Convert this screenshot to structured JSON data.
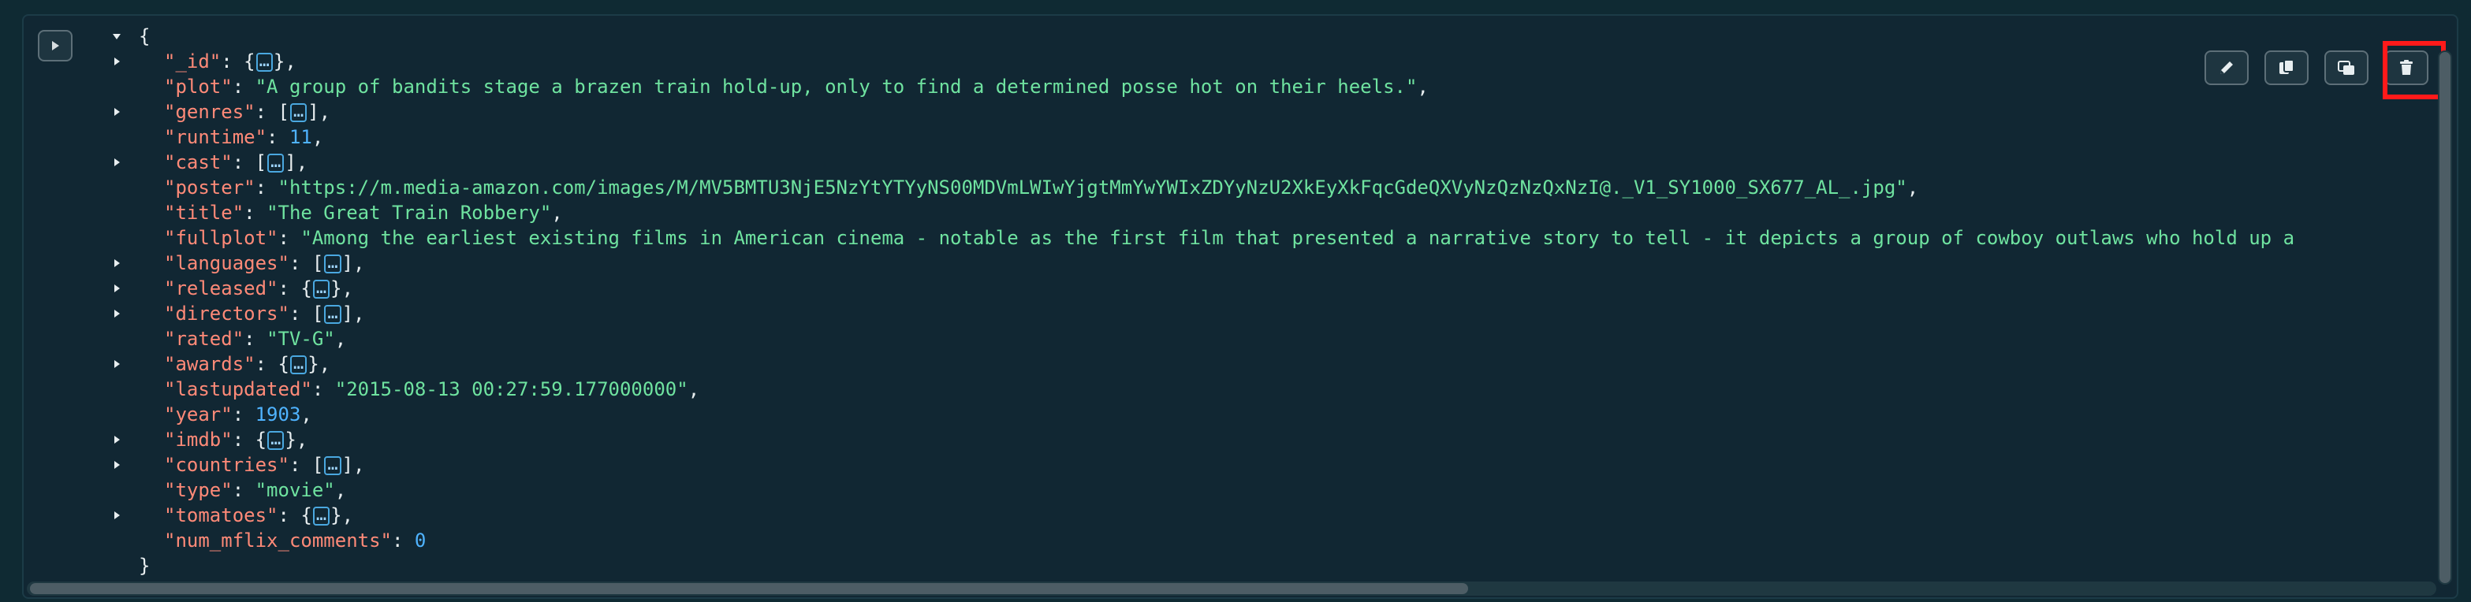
{
  "document": {
    "open_brace": "{",
    "close_brace": "}",
    "fields": [
      {
        "key": "\"_id\"",
        "kind": "object",
        "collapsed": true,
        "open": "{",
        "ellipsis": "…",
        "close": "}",
        "trail": ","
      },
      {
        "key": "\"plot\"",
        "kind": "string",
        "value": "\"A group of bandits stage a brazen train hold-up, only to find a determined posse hot on their heels.\"",
        "trail": ","
      },
      {
        "key": "\"genres\"",
        "kind": "array",
        "collapsed": true,
        "open": "[",
        "ellipsis": "…",
        "close": "]",
        "trail": ","
      },
      {
        "key": "\"runtime\"",
        "kind": "number",
        "value": "11",
        "trail": ","
      },
      {
        "key": "\"cast\"",
        "kind": "array",
        "collapsed": true,
        "open": "[",
        "ellipsis": "…",
        "close": "]",
        "trail": ","
      },
      {
        "key": "\"poster\"",
        "kind": "string",
        "value": "\"https://m.media-amazon.com/images/M/MV5BMTU3NjE5NzYtYTYyNS00MDVmLWIwYjgtMmYwYWIxZDYyNzU2XkEyXkFqcGdeQXVyNzQzNzQxNzI@._V1_SY1000_SX677_AL_.jpg\"",
        "trail": ","
      },
      {
        "key": "\"title\"",
        "kind": "string",
        "value": "\"The Great Train Robbery\"",
        "trail": ","
      },
      {
        "key": "\"fullplot\"",
        "kind": "string",
        "value": "\"Among the earliest existing films in American cinema - notable as the first film that presented a narrative story to tell - it depicts a group of cowboy outlaws who hold up a",
        "trail": ""
      },
      {
        "key": "\"languages\"",
        "kind": "array",
        "collapsed": true,
        "open": "[",
        "ellipsis": "…",
        "close": "]",
        "trail": ","
      },
      {
        "key": "\"released\"",
        "kind": "object",
        "collapsed": true,
        "open": "{",
        "ellipsis": "…",
        "close": "}",
        "trail": ","
      },
      {
        "key": "\"directors\"",
        "kind": "array",
        "collapsed": true,
        "open": "[",
        "ellipsis": "…",
        "close": "]",
        "trail": ","
      },
      {
        "key": "\"rated\"",
        "kind": "string",
        "value": "\"TV-G\"",
        "trail": ","
      },
      {
        "key": "\"awards\"",
        "kind": "object",
        "collapsed": true,
        "open": "{",
        "ellipsis": "…",
        "close": "}",
        "trail": ","
      },
      {
        "key": "\"lastupdated\"",
        "kind": "string",
        "value": "\"2015-08-13 00:27:59.177000000\"",
        "trail": ","
      },
      {
        "key": "\"year\"",
        "kind": "number",
        "value": "1903",
        "trail": ","
      },
      {
        "key": "\"imdb\"",
        "kind": "object",
        "collapsed": true,
        "open": "{",
        "ellipsis": "…",
        "close": "}",
        "trail": ","
      },
      {
        "key": "\"countries\"",
        "kind": "array",
        "collapsed": true,
        "open": "[",
        "ellipsis": "…",
        "close": "]",
        "trail": ","
      },
      {
        "key": "\"type\"",
        "kind": "string",
        "value": "\"movie\"",
        "trail": ","
      },
      {
        "key": "\"tomatoes\"",
        "kind": "object",
        "collapsed": true,
        "open": "{",
        "ellipsis": "…",
        "close": "}",
        "trail": ","
      },
      {
        "key": "\"num_mflix_comments\"",
        "kind": "number",
        "value": "0",
        "trail": ""
      }
    ]
  },
  "toolbar": {
    "icons": [
      "pencil-icon",
      "copy-icon",
      "clone-icon",
      "trash-icon"
    ]
  },
  "colors": {
    "key": "#ff8a78",
    "string": "#6fe3a0",
    "number": "#4fb3ff",
    "highlight": "#ff1a1a",
    "background": "#112733"
  }
}
